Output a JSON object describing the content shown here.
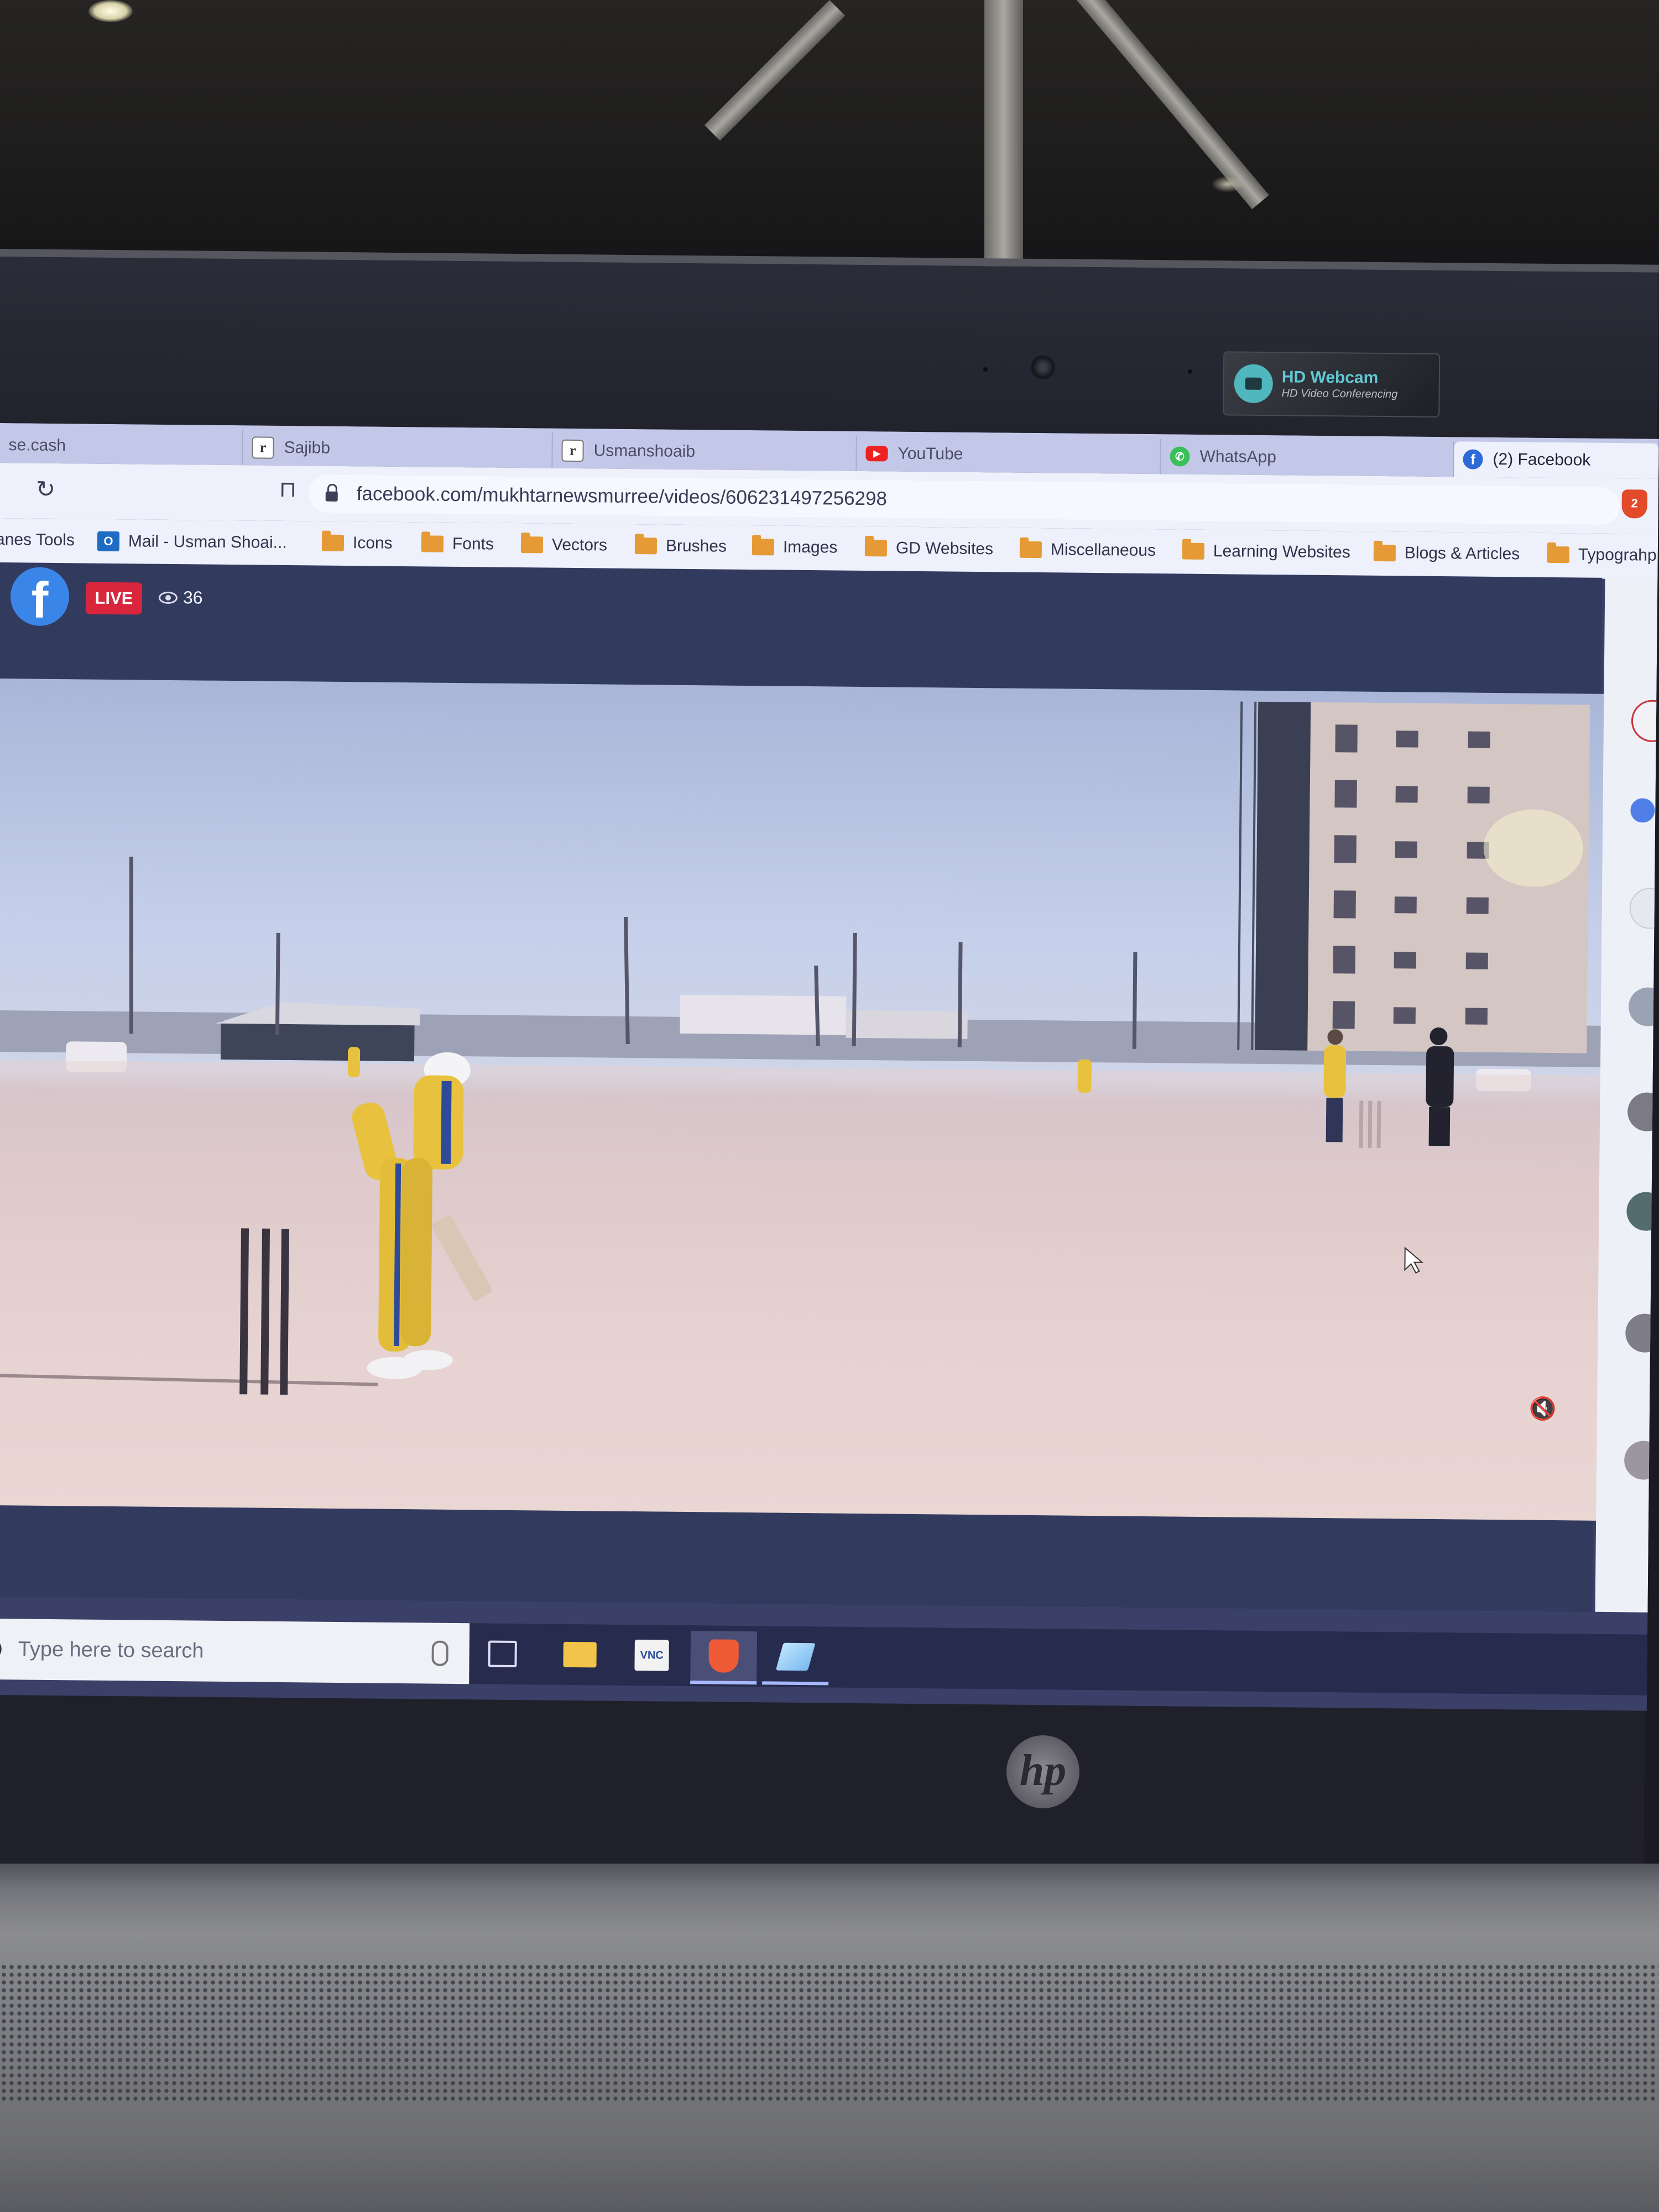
{
  "webcam_sticker": {
    "title": "HD Webcam",
    "subtitle": "HD Video Conferencing"
  },
  "tabs": [
    {
      "label": "se.cash",
      "icon": "none"
    },
    {
      "label": "Sajibb",
      "icon": "r-favicon"
    },
    {
      "label": "Usmanshoaib",
      "icon": "r-favicon"
    },
    {
      "label": "YouTube",
      "icon": "youtube-favicon"
    },
    {
      "label": "WhatsApp",
      "icon": "whatsapp-favicon"
    },
    {
      "label": "(2) Facebook",
      "icon": "facebook-favicon",
      "active": true
    }
  ],
  "address_bar": {
    "url": "facebook.com/mukhtarnewsmurree/videos/606231497256298",
    "extension_badge": "2"
  },
  "bookmarks": [
    {
      "label": "anes Tools",
      "icon": "none"
    },
    {
      "label": "Mail - Usman Shoai...",
      "icon": "outlook-icon"
    },
    {
      "label": "Icons",
      "icon": "folder-icon"
    },
    {
      "label": "Fonts",
      "icon": "folder-icon"
    },
    {
      "label": "Vectors",
      "icon": "folder-icon"
    },
    {
      "label": "Brushes",
      "icon": "folder-icon"
    },
    {
      "label": "Images",
      "icon": "folder-icon"
    },
    {
      "label": "GD Websites",
      "icon": "folder-icon"
    },
    {
      "label": "Miscellaneous",
      "icon": "folder-icon"
    },
    {
      "label": "Learning Websites",
      "icon": "folder-icon"
    },
    {
      "label": "Blogs & Articles",
      "icon": "folder-icon"
    },
    {
      "label": "Typograhp",
      "icon": "folder-icon"
    }
  ],
  "live_header": {
    "badge": "LIVE",
    "viewer_count": "36"
  },
  "taskbar": {
    "search_placeholder": "Type here to search",
    "vnc_label": "VNC"
  },
  "hp_logo": "hp",
  "colors": {
    "live_red": "#d9263c",
    "facebook_blue": "#3a86e8",
    "taskbar": "#272b4d"
  }
}
